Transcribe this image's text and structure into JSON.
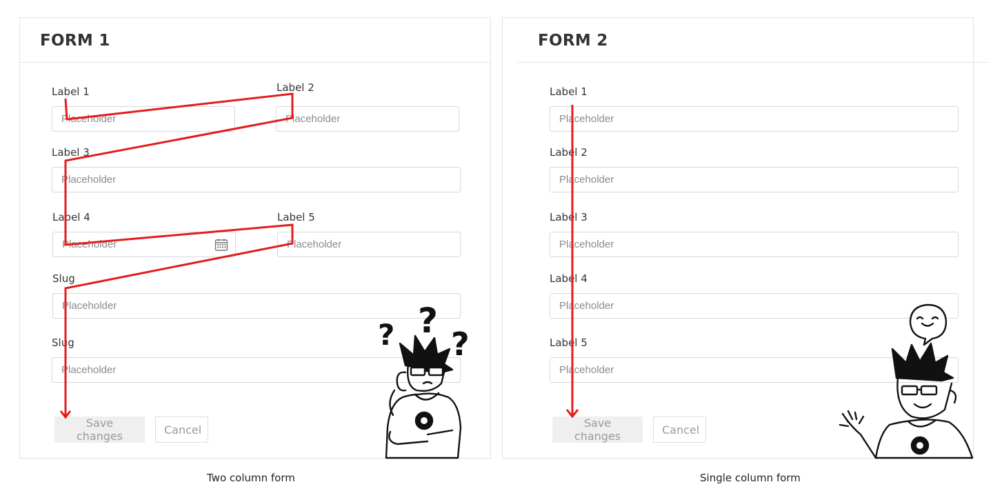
{
  "form1": {
    "title": "FORM 1",
    "labels": [
      "Label 1",
      "Label 2",
      "Label 3",
      "Label 4",
      "Label 5",
      "Slug",
      "Slug"
    ],
    "placeholder": "Placeholder",
    "save_label": "Save changes",
    "cancel_label": "Cancel",
    "caption": "Two column form",
    "flow_color": "#e31b1b"
  },
  "form2": {
    "title": "FORM 2",
    "labels": [
      "Label 1",
      "Label 2",
      "Label 3",
      "Label 4",
      "Label 5"
    ],
    "placeholder": "Placeholder",
    "save_label": "Save changes",
    "cancel_label": "Cancel",
    "caption": "Single column form",
    "flow_color": "#e31b1b"
  },
  "icons": {
    "date_picker": "calendar-icon",
    "confused_character": "confused-person-illustration",
    "happy_character": "happy-person-illustration"
  }
}
